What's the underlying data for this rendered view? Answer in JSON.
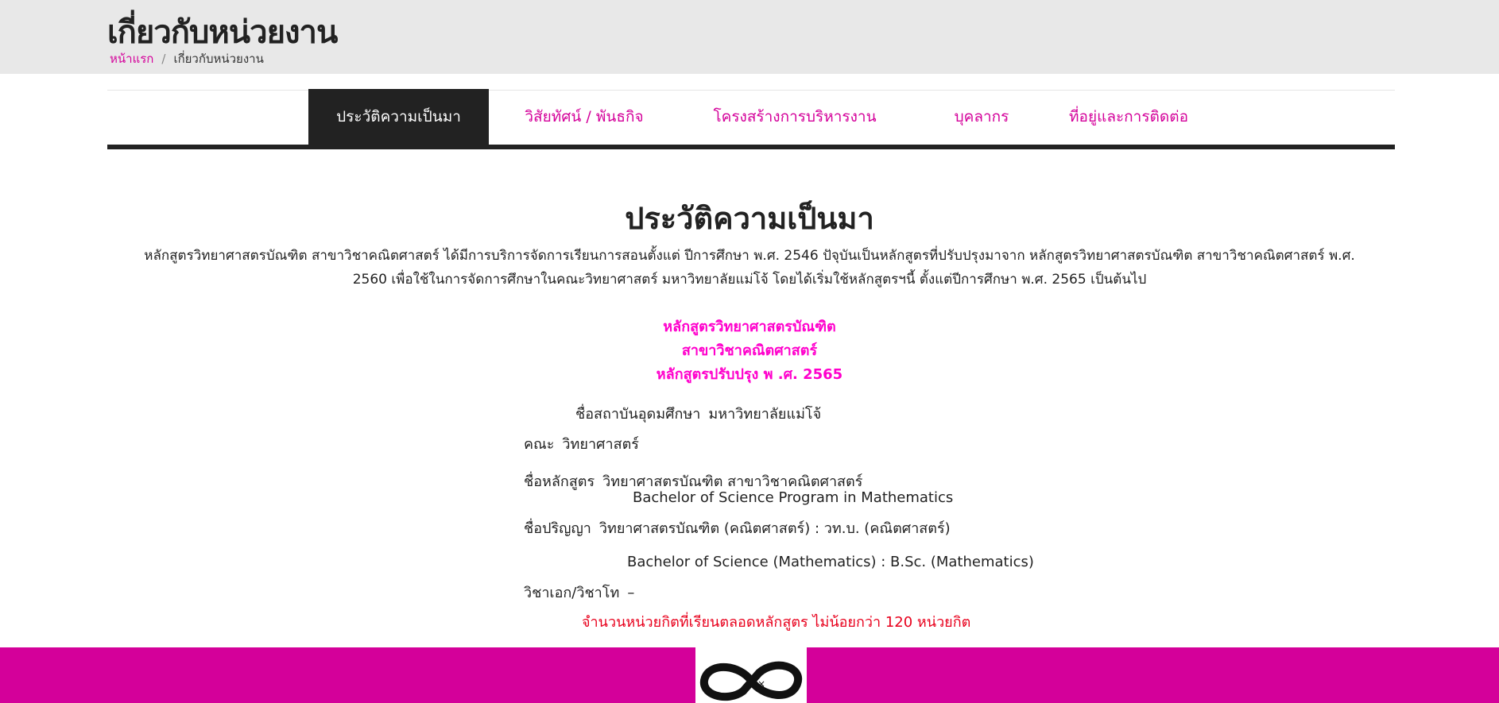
{
  "header": {
    "title": "เกี่ยวกับหน่วยงาน",
    "breadcrumb": {
      "home": "หน้าแรก",
      "separator": "/",
      "current": "เกี่ยวกับหน่วยงาน"
    }
  },
  "tabs": [
    {
      "label": "ประวัติความเป็นมา",
      "active": true
    },
    {
      "label": "วิสัยทัศน์ / พันธกิจ",
      "active": false
    },
    {
      "label": "โครงสร้างการบริหารงาน",
      "active": false
    },
    {
      "label": "บุคลากร",
      "active": false
    },
    {
      "label": "ที่อยู่และการติดต่อ",
      "active": false
    }
  ],
  "content": {
    "title": "ประวัติความเป็นมา",
    "intro": "หลักสูตรวิทยาศาสตรบัณฑิต  สาขาวิชาคณิตศาสตร์ ได้มีการบริการจัดการเรียนการสอนตั้งแต่ ปีการศึกษา พ.ศ. 2546 ปัจุบันเป็นหลักสูตรที่ปรับปรุงมาจาก หลักสูตรวิทยาศาสตรบัณฑิต สาขาวิชาคณิตศาสตร์ พ.ศ. 2560 เพื่อใช้ในการจัดการศึกษาในคณะวิทยาศาสตร์ มหาวิทยาลัยแม่โจ้ โดยได้เริ่มใช้หลักสูตรฯนี้ ตั้งแต่ปีการศึกษา พ.ศ. 2565 เป็นต้นไป",
    "program": {
      "line1": "หลักสูตรวิทยาศาสตรบัณฑิต",
      "line2": "สาขาวิชาคณิตศาสตร์",
      "line3": "หลักสูตรปรับปรุง พ .ศ. 2565"
    },
    "institution": {
      "label": "ชื่อสถาบันอุดมศึกษา",
      "value": "มหาวิทยาลัยแม่โจ้"
    },
    "faculty": {
      "label": "คณะ",
      "value": "วิทยาศาสตร์"
    },
    "program_name": {
      "label": "ชื่อหลักสูตร",
      "value_th": "วิทยาศาสตรบัณฑิต สาขาวิชาคณิตศาสตร์",
      "value_en": "Bachelor of Science Program in Mathematics"
    },
    "degree": {
      "label": "ชื่อปริญญา",
      "value_th": "วิทยาศาสตรบัณฑิต (คณิตศาสตร์) : วท.บ. (คณิตศาสตร์)",
      "value_en": "Bachelor of Science (Mathematics) : B.Sc. (Mathematics)"
    },
    "major": {
      "label": "วิชาเอก/วิชาโท",
      "value": "–"
    },
    "credits": "จำนวนหน่วยกิตที่เรียนตลอดหลักสูตร   ไม่น้อยกว่า 120 หน่วยกิต"
  },
  "colors": {
    "accent": "#d4009a",
    "dark": "#222222",
    "program_text": "#ff00cc",
    "credits_text": "#e8001c"
  },
  "footer": {
    "logo_icon": "infinity-logo-icon"
  }
}
